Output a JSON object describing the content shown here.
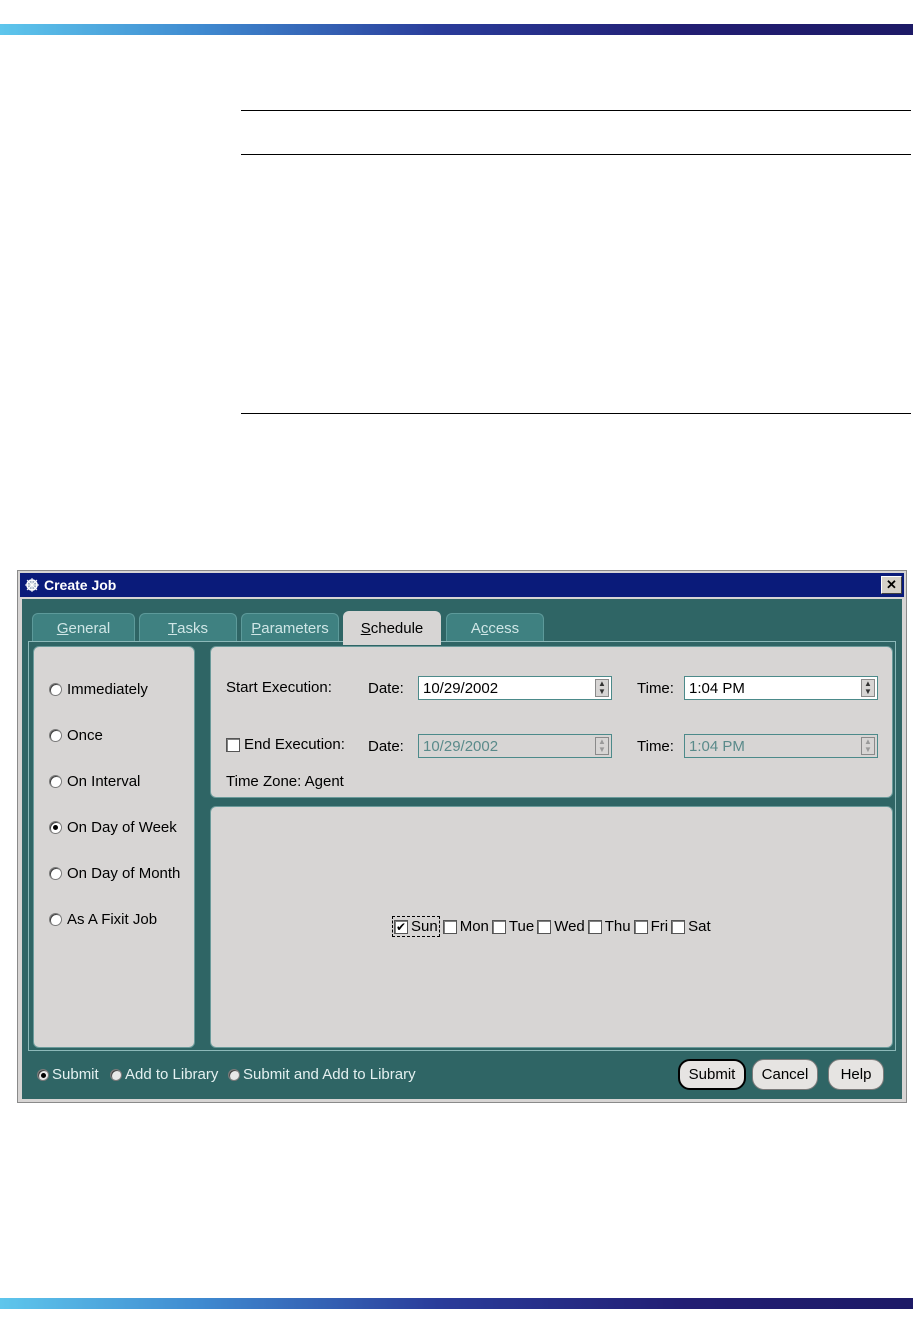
{
  "window": {
    "title": "Create Job",
    "close_label": "✕"
  },
  "tabs": [
    {
      "label": "General",
      "key": "G",
      "rest": "eneral"
    },
    {
      "label": "Tasks",
      "key": "T",
      "rest": "asks"
    },
    {
      "label": "Parameters",
      "key": "P",
      "rest": "arameters"
    },
    {
      "label": "Schedule",
      "key": "S",
      "rest": "chedule"
    },
    {
      "label": "Access",
      "key": "Access"
    }
  ],
  "tab_access_parts": {
    "pre": "A",
    "key": "c",
    "post": "cess"
  },
  "schedule_types": [
    {
      "label": "Immediately",
      "selected": false
    },
    {
      "label": "Once",
      "selected": false
    },
    {
      "label": "On Interval",
      "selected": false
    },
    {
      "label": "On Day of Week",
      "selected": true
    },
    {
      "label": "On Day of Month",
      "selected": false
    },
    {
      "label": "As A Fixit Job",
      "selected": false
    }
  ],
  "execution": {
    "start_label": "Start Execution:",
    "end_label": "End Execution:",
    "end_checked": false,
    "date_label": "Date:",
    "time_label": "Time:",
    "start_date": "10/29/2002",
    "start_time": "1:04 PM",
    "end_date": "10/29/2002",
    "end_time": "1:04 PM",
    "time_zone": "Time Zone: Agent"
  },
  "days": [
    {
      "label": "Sun",
      "checked": true
    },
    {
      "label": "Mon",
      "checked": false
    },
    {
      "label": "Tue",
      "checked": false
    },
    {
      "label": "Wed",
      "checked": false
    },
    {
      "label": "Thu",
      "checked": false
    },
    {
      "label": "Fri",
      "checked": false
    },
    {
      "label": "Sat",
      "checked": false
    }
  ],
  "footer": {
    "options": [
      {
        "label": "Submit",
        "selected": true
      },
      {
        "label": "Add to Library",
        "selected": false
      },
      {
        "label": "Submit and Add to Library",
        "selected": false
      }
    ],
    "buttons": {
      "submit": "Submit",
      "cancel": "Cancel",
      "help": "Help"
    }
  },
  "colors": {
    "title_bar": "#0a1b7a",
    "panel_bg": "#2f6565",
    "surface": "#d7d5d4"
  }
}
